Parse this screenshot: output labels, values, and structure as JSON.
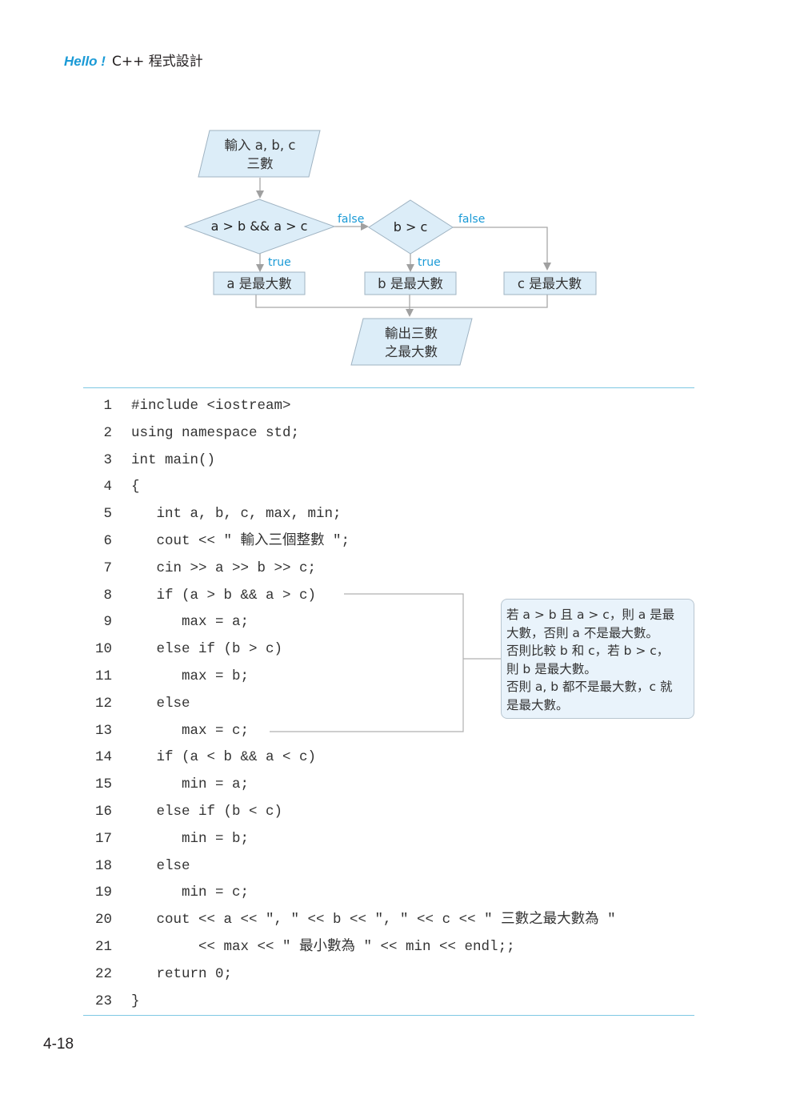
{
  "header": {
    "brand": "Hello !",
    "title": "C++ 程式設計"
  },
  "flowchart": {
    "input": {
      "line1": "輸入 a, b, c",
      "line2": "三數"
    },
    "decision1": "a > b && a > c",
    "decision2": "b > c",
    "labels": {
      "true": "true",
      "false": "false"
    },
    "box_a": "a 是最大數",
    "box_b": "b 是最大數",
    "box_c": "c 是最大數",
    "output": {
      "line1": "輸出三數",
      "line2": "之最大數"
    },
    "colors": {
      "fill": "#dcedf8",
      "stroke": "#9fb3c2",
      "arrow": "#a0a0a0",
      "label": "#1a9ad6"
    }
  },
  "code": {
    "lines": [
      {
        "n": "1",
        "text": "#include <iostream>"
      },
      {
        "n": "2",
        "text": "using namespace std;"
      },
      {
        "n": "3",
        "text": "int main()"
      },
      {
        "n": "4",
        "text": "{"
      },
      {
        "n": "5",
        "text": "   int a, b, c, max, min;"
      },
      {
        "n": "6",
        "text": "   cout << \" 輸入三個整數 \";"
      },
      {
        "n": "7",
        "text": "   cin >> a >> b >> c;"
      },
      {
        "n": "8",
        "text": "   if (a > b && a > c)"
      },
      {
        "n": "9",
        "text": "      max = a;"
      },
      {
        "n": "10",
        "text": "   else if (b > c)"
      },
      {
        "n": "11",
        "text": "      max = b;"
      },
      {
        "n": "12",
        "text": "   else"
      },
      {
        "n": "13",
        "text": "      max = c;"
      },
      {
        "n": "14",
        "text": "   if (a < b && a < c)"
      },
      {
        "n": "15",
        "text": "      min = a;"
      },
      {
        "n": "16",
        "text": "   else if (b < c)"
      },
      {
        "n": "17",
        "text": "      min = b;"
      },
      {
        "n": "18",
        "text": "   else"
      },
      {
        "n": "19",
        "text": "      min = c;"
      },
      {
        "n": "20",
        "text": "   cout << a << \", \" << b << \", \" << c << \" 三數之最大數為 \""
      },
      {
        "n": "21",
        "text": "        << max << \" 最小數為 \" << min << endl;;"
      },
      {
        "n": "22",
        "text": "   return 0;"
      },
      {
        "n": "23",
        "text": "}"
      }
    ]
  },
  "note": {
    "lines": [
      "若 a > b 且 a > c，則 a 是最",
      "大數，否則 a 不是最大數。",
      "否則比較 b 和 c，若 b > c，",
      "則 b 是最大數。",
      "否則 a, b 都不是最大數，c 就",
      "是最大數。"
    ]
  },
  "page_number": "4-18"
}
